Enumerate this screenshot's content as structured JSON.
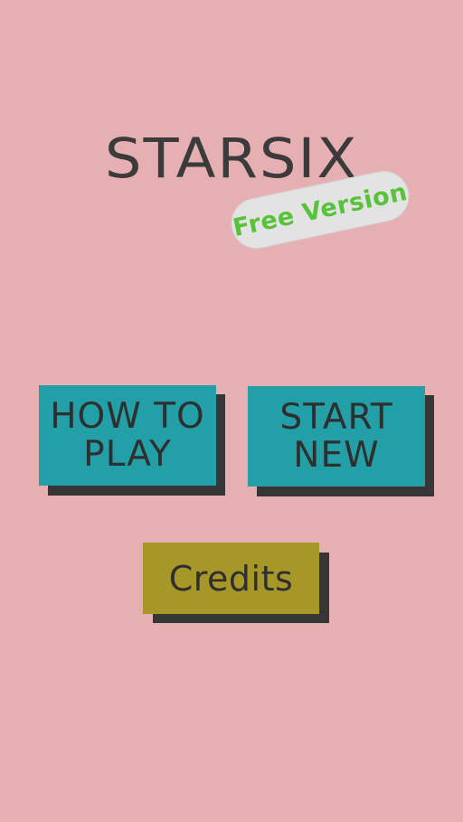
{
  "app": {
    "title": "STARSIX",
    "badge": "Free Version"
  },
  "menu": {
    "how_to_play": "HOW TO\nPLAY",
    "start_new": "START\nNEW",
    "credits": "Credits"
  },
  "colors": {
    "background": "#e6b0b2",
    "title_text": "#3b3b3b",
    "badge_bg": "#e3e3e3",
    "badge_text": "#58c23a",
    "primary_button": "#239fa7",
    "credits_button": "#a79729",
    "button_shadow": "#363636",
    "button_text": "#2f2f2f"
  }
}
